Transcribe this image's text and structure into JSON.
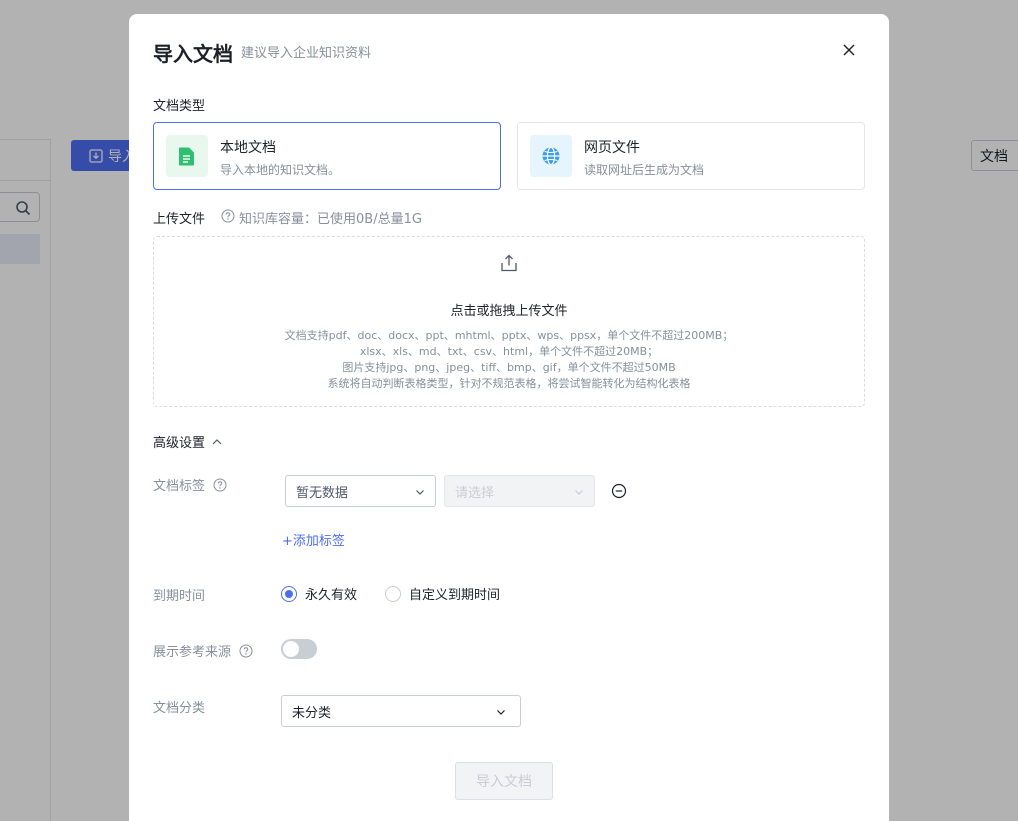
{
  "background": {
    "import_button_label": "导入",
    "doc_select_label": "文档",
    "overlay_color": "rgba(0,0,0,0.30)"
  },
  "modal": {
    "title": "导入文档",
    "subtitle": "建议导入企业知识资料",
    "doc_type_label": "文档类型",
    "doc_types": [
      {
        "title": "本地文档",
        "desc": "导入本地的知识文档。",
        "icon": "file-doc-icon",
        "icon_color": "#2fbf71",
        "icon_bg": "#e8f8ef",
        "selected": true
      },
      {
        "title": "网页文件",
        "desc": "读取网址后生成为文档",
        "icon": "globe-icon",
        "icon_color": "#3b9ee8",
        "icon_bg": "#e6f4fd",
        "selected": false
      }
    ],
    "upload_label": "上传文件",
    "capacity_text": "知识库容量：已使用0B/总量1G",
    "upload": {
      "main_text": "点击或拖拽上传文件",
      "hints": [
        "文档支持pdf、doc、docx、ppt、mhtml、pptx、wps、ppsx，单个文件不超过200MB；",
        "xlsx、xls、md、txt、csv、html，单个文件不超过20MB；",
        "图片支持jpg、png、jpeg、tiff、bmp、gif，单个文件不超过50MB",
        "系统将自动判断表格类型，针对不规范表格，将尝试智能转化为结构化表格"
      ]
    },
    "advanced_label": "高级设置",
    "tags": {
      "label": "文档标签",
      "first_select": "暂无数据",
      "second_placeholder": "请选择",
      "add_label": "+添加标签"
    },
    "expiry": {
      "label": "到期时间",
      "options": [
        {
          "label": "永久有效",
          "checked": true
        },
        {
          "label": "自定义到期时间",
          "checked": false
        }
      ]
    },
    "show_source": {
      "label": "展示参考来源",
      "enabled": false
    },
    "category": {
      "label": "文档分类",
      "value": "未分类"
    },
    "submit_label": "导入文档",
    "accent_color": "#4e6ef2"
  }
}
